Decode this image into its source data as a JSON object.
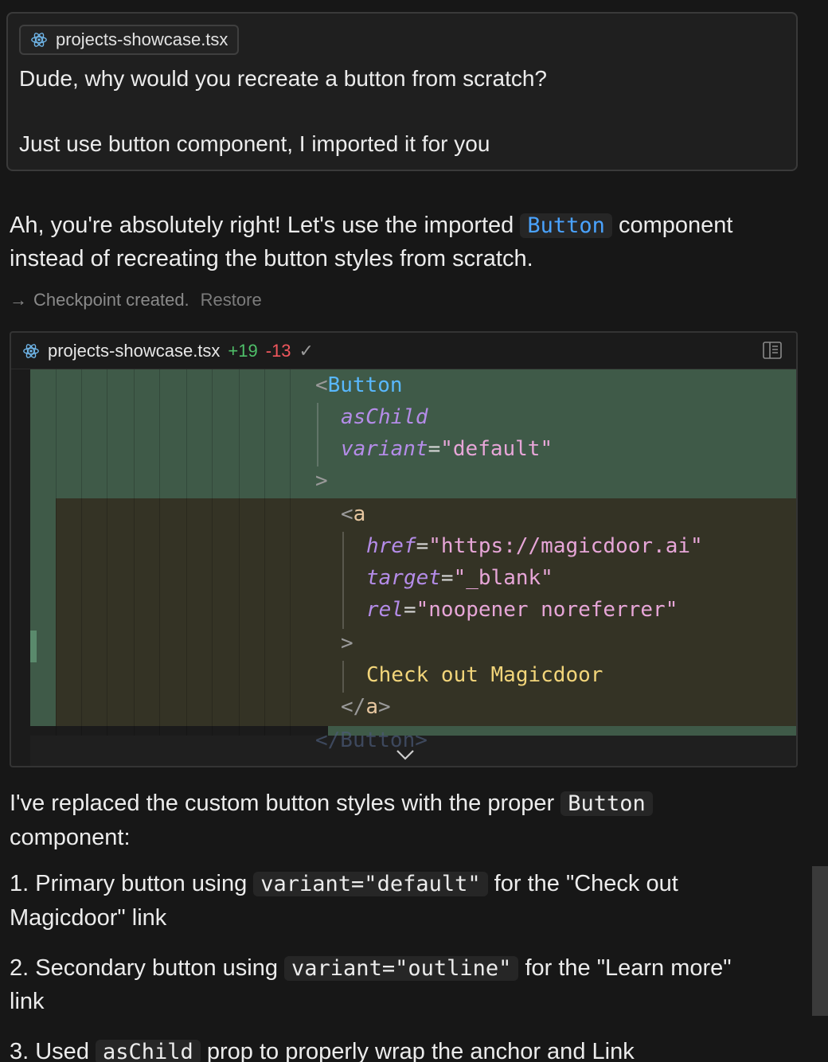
{
  "user_message": {
    "file_chip": {
      "icon": "react-icon",
      "filename": "projects-showcase.tsx"
    },
    "line1": "Dude, why would you recreate a button from scratch?",
    "line2": "Just use button component, I imported it for you"
  },
  "assistant": {
    "intro": {
      "before": "Ah, you're absolutely right! Let's use the imported",
      "code": "Button",
      "after": "component",
      "line2": "instead of recreating the button styles from scratch."
    },
    "checkpoint": {
      "arrow": "→",
      "text": "Checkpoint created.",
      "restore_label": "Restore"
    },
    "diff": {
      "filename": "projects-showcase.tsx",
      "additions": "+19",
      "deletions": "-13",
      "status": "✓",
      "lines": {
        "l1_open": "<",
        "l1_tag": "Button",
        "l2_attr": "asChild",
        "l3_attr": "variant",
        "l3_eq": "=",
        "l3_val": "\"default\"",
        "l4": ">",
        "l5_open": "<",
        "l5_tag": "a",
        "l6_attr": "href",
        "l6_eq": "=",
        "l6_val": "\"https://magicdoor.ai\"",
        "l7_attr": "target",
        "l7_eq": "=",
        "l7_val": "\"_blank\"",
        "l8_attr": "rel",
        "l8_eq": "=",
        "l8_val": "\"noopener noreferrer\"",
        "l9": ">",
        "l10_text": "Check out Magicdoor",
        "l11_open": "</",
        "l11_tag": "a",
        "l11_close": ">",
        "l12": "</Button>"
      }
    },
    "summary": {
      "line1_before": "I've replaced the custom button styles with the proper",
      "line1_code": "Button",
      "line2": "component:",
      "item1_before": "1. Primary button using",
      "item1_code": "variant=\"default\"",
      "item1_after": "for the \"Check out",
      "item1_line2": "Magicdoor\" link",
      "item2_before": "2. Secondary button using",
      "item2_code": "variant=\"outline\"",
      "item2_after": "for the \"Learn more\"",
      "item2_line2": "link",
      "item3_before": "3. Used",
      "item3_code": "asChild",
      "item3_after": "prop to properly wrap the anchor and Link"
    }
  },
  "colors": {
    "background": "#171717",
    "added_band": "#3f5a48",
    "modified_band": "#343325",
    "additions": "#4fbf69",
    "deletions": "#f0575d",
    "inline_code_blue": "#4aa3ff"
  }
}
